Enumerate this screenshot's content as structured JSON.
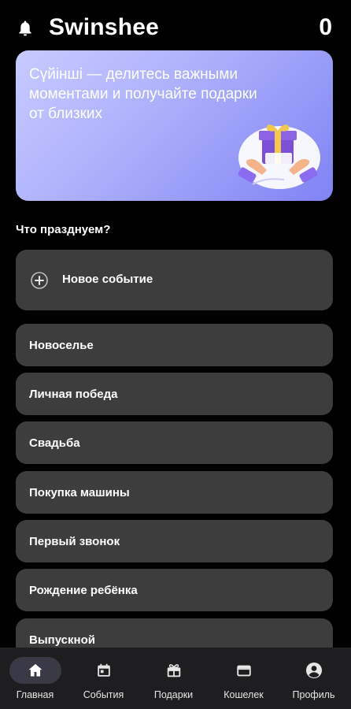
{
  "header": {
    "title": "Swinshee",
    "balance": "0"
  },
  "banner": {
    "text": "Сүйінші — делитесь важными моментами и получайте подарки от близких"
  },
  "section_title": "Что празднуем?",
  "new_event": {
    "label": "Новое событие"
  },
  "events": [
    {
      "label": "Новоселье"
    },
    {
      "label": "Личная победа"
    },
    {
      "label": "Свадьба"
    },
    {
      "label": "Покупка машины"
    },
    {
      "label": "Первый звонок"
    },
    {
      "label": "Рождение ребёнка"
    },
    {
      "label": "Выпускной"
    }
  ],
  "nav": [
    {
      "label": "Главная",
      "icon": "home-icon",
      "active": true
    },
    {
      "label": "События",
      "icon": "calendar-icon",
      "active": false
    },
    {
      "label": "Подарки",
      "icon": "gift-icon",
      "active": false
    },
    {
      "label": "Кошелек",
      "icon": "wallet-icon",
      "active": false
    },
    {
      "label": "Профиль",
      "icon": "profile-icon",
      "active": false
    }
  ],
  "colors": {
    "background": "#000000",
    "card": "#3d3d3d",
    "banner_start": "#c7cbff",
    "banner_end": "#8083f3",
    "nav_bg": "#1e1e20"
  }
}
